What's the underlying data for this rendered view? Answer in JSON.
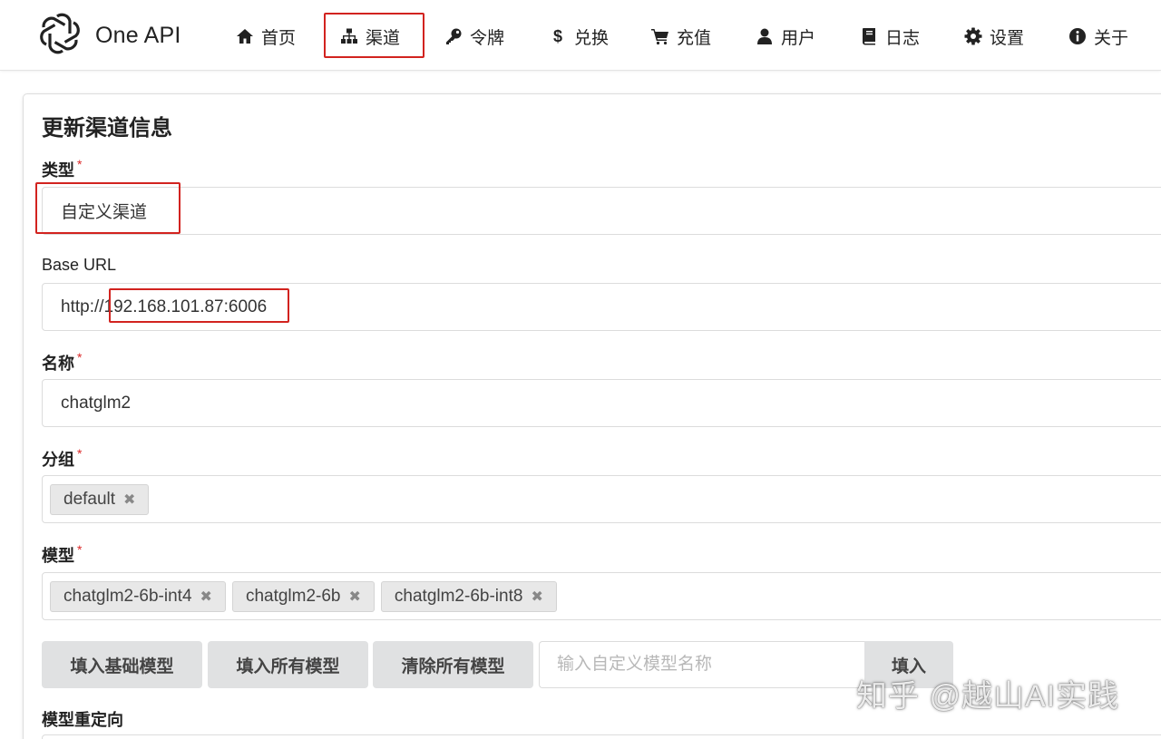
{
  "brand": {
    "name": "One API"
  },
  "nav": [
    {
      "label": "首页",
      "icon": "home-icon"
    },
    {
      "label": "渠道",
      "icon": "sitemap-icon"
    },
    {
      "label": "令牌",
      "icon": "key-icon"
    },
    {
      "label": "兑换",
      "icon": "dollar-icon"
    },
    {
      "label": "充值",
      "icon": "cart-icon"
    },
    {
      "label": "用户",
      "icon": "user-icon"
    },
    {
      "label": "日志",
      "icon": "book-icon"
    },
    {
      "label": "设置",
      "icon": "gear-icon"
    },
    {
      "label": "关于",
      "icon": "info-icon"
    }
  ],
  "form": {
    "title": "更新渠道信息",
    "type": {
      "label": "类型",
      "required_mark": "*",
      "value": "自定义渠道"
    },
    "base_url": {
      "label": "Base URL",
      "value": "http://192.168.101.87:6006"
    },
    "name": {
      "label": "名称",
      "required_mark": "*",
      "value": "chatglm2"
    },
    "group": {
      "label": "分组",
      "required_mark": "*",
      "chips": [
        "default"
      ]
    },
    "models": {
      "label": "模型",
      "required_mark": "*",
      "chips": [
        "chatglm2-6b-int4",
        "chatglm2-6b",
        "chatglm2-6b-int8"
      ]
    },
    "buttons": {
      "fill_basic": "填入基础模型",
      "fill_all": "填入所有模型",
      "clear_all": "清除所有模型",
      "fill": "填入"
    },
    "custom_model": {
      "placeholder": "输入自定义模型名称"
    },
    "model_mapping": {
      "label": "模型重定向"
    }
  },
  "chip_remove_glyph": "✖",
  "watermark": "知乎 @越山AI实践",
  "colors": {
    "annotation_red": "#d2231f",
    "required_red": "#db2828",
    "button_grey": "#e0e1e2"
  }
}
